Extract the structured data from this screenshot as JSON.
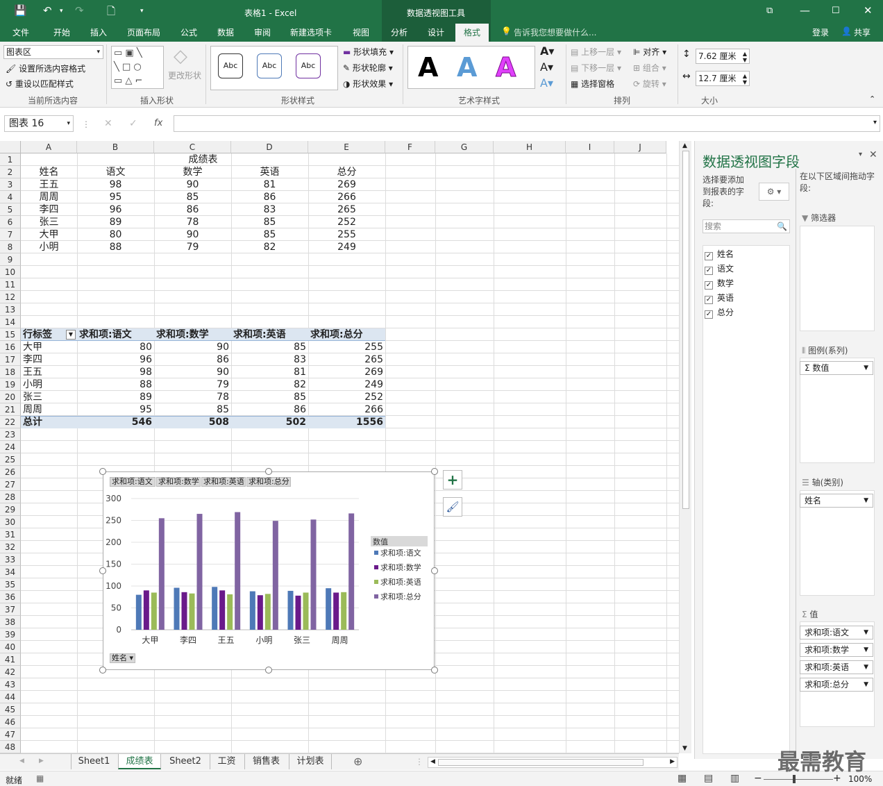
{
  "app": {
    "doc_title": "表格1 - Excel",
    "context_tool": "数据透视图工具",
    "help_placeholder": "告诉我您想要做什么...",
    "login": "登录",
    "share": "共享"
  },
  "tabs": [
    "文件",
    "开始",
    "插入",
    "页面布局",
    "公式",
    "数据",
    "审阅",
    "新建选项卡",
    "视图",
    "分析",
    "设计",
    "格式"
  ],
  "ribbon": {
    "current_selection": {
      "dropdown": "图表区",
      "format_selection": "设置所选内容格式",
      "reset_style": "重设以匹配样式",
      "label": "当前所选内容"
    },
    "insert_shapes": {
      "change_shape": "更改形状",
      "label": "插入形状"
    },
    "shape_styles": {
      "samples": [
        "Abc",
        "Abc",
        "Abc"
      ],
      "fill": "形状填充",
      "outline": "形状轮廓",
      "effects": "形状效果",
      "label": "形状样式"
    },
    "wordart": {
      "samples": [
        "A",
        "A",
        "A"
      ],
      "label": "艺术字样式"
    },
    "arrange": {
      "bring_forward": "上移一层",
      "send_backward": "下移一层",
      "selection_pane": "选择窗格",
      "align": "对齐",
      "group": "组合",
      "rotate": "旋转",
      "label": "排列"
    },
    "size": {
      "height": "7.62 厘米",
      "width": "12.7 厘米",
      "label": "大小"
    }
  },
  "formula_bar": {
    "name_box": "图表 16",
    "fx": "fx",
    "value": ""
  },
  "columns": [
    "A",
    "B",
    "C",
    "D",
    "E",
    "F",
    "G",
    "H",
    "I",
    "J"
  ],
  "rows": [
    "1",
    "2",
    "3",
    "4",
    "5",
    "6",
    "7",
    "8",
    "9",
    "10",
    "11",
    "12",
    "13",
    "14",
    "15",
    "16",
    "17",
    "18",
    "19",
    "20",
    "21",
    "22",
    "23",
    "24",
    "25",
    "26",
    "27",
    "28",
    "29",
    "30",
    "31",
    "32",
    "33",
    "34",
    "35",
    "36",
    "37",
    "38",
    "39",
    "40",
    "41",
    "42",
    "43",
    "44",
    "45",
    "46",
    "47",
    "48"
  ],
  "score_table": {
    "title": "成绩表",
    "headers": [
      "姓名",
      "语文",
      "数学",
      "英语",
      "总分"
    ],
    "rows": [
      [
        "王五",
        "98",
        "90",
        "81",
        "269"
      ],
      [
        "周周",
        "95",
        "85",
        "86",
        "266"
      ],
      [
        "李四",
        "96",
        "86",
        "83",
        "265"
      ],
      [
        "张三",
        "89",
        "78",
        "85",
        "252"
      ],
      [
        "大甲",
        "80",
        "90",
        "85",
        "255"
      ],
      [
        "小明",
        "88",
        "79",
        "82",
        "249"
      ]
    ]
  },
  "pivot": {
    "headers": [
      "行标签",
      "求和项:语文",
      "求和项:数学",
      "求和项:英语",
      "求和项:总分"
    ],
    "rows": [
      [
        "大甲",
        "80",
        "90",
        "85",
        "255"
      ],
      [
        "李四",
        "96",
        "86",
        "83",
        "265"
      ],
      [
        "王五",
        "98",
        "90",
        "81",
        "269"
      ],
      [
        "小明",
        "88",
        "79",
        "82",
        "249"
      ],
      [
        "张三",
        "89",
        "78",
        "85",
        "252"
      ],
      [
        "周周",
        "95",
        "85",
        "86",
        "266"
      ]
    ],
    "total": [
      "总计",
      "546",
      "508",
      "502",
      "1556"
    ]
  },
  "chart_field_buttons": [
    "求和项:语文",
    "求和项:数学",
    "求和项:英语",
    "求和项:总分"
  ],
  "chart_axis_button": "姓名",
  "chart_data": {
    "type": "bar",
    "categories": [
      "大甲",
      "李四",
      "王五",
      "小明",
      "张三",
      "周周"
    ],
    "series": [
      {
        "name": "求和项:语文",
        "values": [
          80,
          96,
          98,
          88,
          89,
          95
        ],
        "color": "#4e79b7"
      },
      {
        "name": "求和项:数学",
        "values": [
          90,
          86,
          90,
          79,
          78,
          85
        ],
        "color": "#6a1a8a"
      },
      {
        "name": "求和项:英语",
        "values": [
          85,
          83,
          81,
          82,
          85,
          86
        ],
        "color": "#9bbb59"
      },
      {
        "name": "求和项:总分",
        "values": [
          255,
          265,
          269,
          249,
          252,
          266
        ],
        "color": "#8064a2"
      }
    ],
    "yticks": [
      "300",
      "250",
      "200",
      "150",
      "100",
      "50",
      "0"
    ],
    "ylim": [
      0,
      300
    ],
    "legend_title": "数值",
    "legend_position": "right",
    "grid": true
  },
  "panel": {
    "title": "数据透视图字段",
    "choose_fields": "选择要添加到报表的字段:",
    "drag_hint": "在以下区域间拖动字段:",
    "search_placeholder": "搜索",
    "fields": [
      "姓名",
      "语文",
      "数学",
      "英语",
      "总分"
    ],
    "filters_label": "筛选器",
    "legend_label": "图例(系列)",
    "legend_items": [
      "数值"
    ],
    "axis_label": "轴(类别)",
    "axis_items": [
      "姓名"
    ],
    "values_label": "值",
    "values_items": [
      "求和项:语文",
      "求和项:数学",
      "求和项:英语",
      "求和项:总分"
    ]
  },
  "sheets": [
    "Sheet1",
    "成绩表",
    "Sheet2",
    "工资",
    "销售表",
    "计划表"
  ],
  "active_sheet": "成绩表",
  "status": {
    "ready": "就绪",
    "zoom": "100%"
  },
  "watermark": "最需教育"
}
